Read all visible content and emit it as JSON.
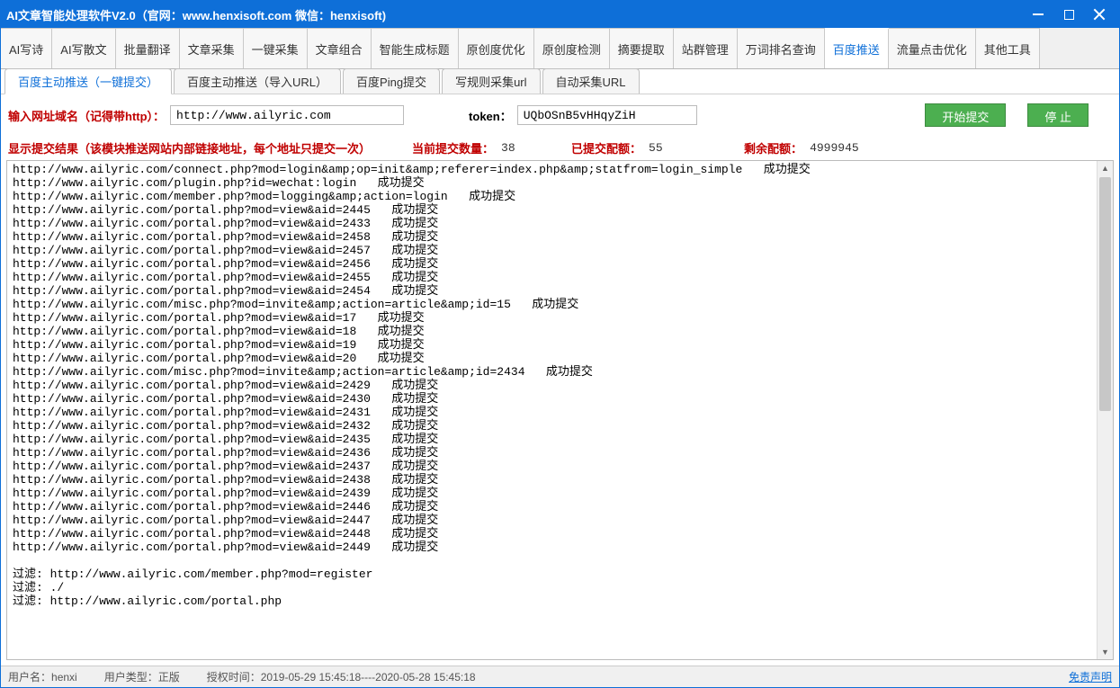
{
  "title": "AI文章智能处理软件V2.0（官网：www.henxisoft.com  微信：henxisoft)",
  "main_tabs": [
    "AI写诗",
    "AI写散文",
    "批量翻译",
    "文章采集",
    "一键采集",
    "文章组合",
    "智能生成标题",
    "原创度优化",
    "原创度检测",
    "摘要提取",
    "站群管理",
    "万词排名查询",
    "百度推送",
    "流量点击优化",
    "其他工具"
  ],
  "main_tab_active": 12,
  "sub_tabs": [
    "百度主动推送（一键提交）",
    "百度主动推送（导入URL）",
    "百度Ping提交",
    "写规则采集url",
    "自动采集URL"
  ],
  "sub_tab_active": 0,
  "input_row": {
    "domain_label": "输入网址域名（记得带http）：",
    "domain_value": "http://www.ailyric.com",
    "token_label": "token：",
    "token_value": "UQbOSnB5vHHqyZiH",
    "start_btn": "开始提交",
    "stop_btn": "停 止"
  },
  "result_header": {
    "title": "显示提交结果（该模块推送网站内部链接地址，每个地址只提交一次）",
    "current_label": "当前提交数量：",
    "current_value": "38",
    "done_label": "已提交配额：",
    "done_value": "55",
    "remain_label": "剩余配额：",
    "remain_value": "4999945"
  },
  "log_lines": [
    "http://www.ailyric.com/connect.php?mod=login&amp;op=init&amp;referer=index.php&amp;statfrom=login_simple   成功提交",
    "http://www.ailyric.com/plugin.php?id=wechat:login   成功提交",
    "http://www.ailyric.com/member.php?mod=logging&amp;action=login   成功提交",
    "http://www.ailyric.com/portal.php?mod=view&aid=2445   成功提交",
    "http://www.ailyric.com/portal.php?mod=view&aid=2433   成功提交",
    "http://www.ailyric.com/portal.php?mod=view&aid=2458   成功提交",
    "http://www.ailyric.com/portal.php?mod=view&aid=2457   成功提交",
    "http://www.ailyric.com/portal.php?mod=view&aid=2456   成功提交",
    "http://www.ailyric.com/portal.php?mod=view&aid=2455   成功提交",
    "http://www.ailyric.com/portal.php?mod=view&aid=2454   成功提交",
    "http://www.ailyric.com/misc.php?mod=invite&amp;action=article&amp;id=15   成功提交",
    "http://www.ailyric.com/portal.php?mod=view&aid=17   成功提交",
    "http://www.ailyric.com/portal.php?mod=view&aid=18   成功提交",
    "http://www.ailyric.com/portal.php?mod=view&aid=19   成功提交",
    "http://www.ailyric.com/portal.php?mod=view&aid=20   成功提交",
    "http://www.ailyric.com/misc.php?mod=invite&amp;action=article&amp;id=2434   成功提交",
    "http://www.ailyric.com/portal.php?mod=view&aid=2429   成功提交",
    "http://www.ailyric.com/portal.php?mod=view&aid=2430   成功提交",
    "http://www.ailyric.com/portal.php?mod=view&aid=2431   成功提交",
    "http://www.ailyric.com/portal.php?mod=view&aid=2432   成功提交",
    "http://www.ailyric.com/portal.php?mod=view&aid=2435   成功提交",
    "http://www.ailyric.com/portal.php?mod=view&aid=2436   成功提交",
    "http://www.ailyric.com/portal.php?mod=view&aid=2437   成功提交",
    "http://www.ailyric.com/portal.php?mod=view&aid=2438   成功提交",
    "http://www.ailyric.com/portal.php?mod=view&aid=2439   成功提交",
    "http://www.ailyric.com/portal.php?mod=view&aid=2446   成功提交",
    "http://www.ailyric.com/portal.php?mod=view&aid=2447   成功提交",
    "http://www.ailyric.com/portal.php?mod=view&aid=2448   成功提交",
    "http://www.ailyric.com/portal.php?mod=view&aid=2449   成功提交",
    "",
    "过滤: http://www.ailyric.com/member.php?mod=register",
    "过滤: ./",
    "过滤: http://www.ailyric.com/portal.php"
  ],
  "statusbar": {
    "user_label": "用户名：",
    "user_value": "henxi",
    "type_label": "用户类型：",
    "type_value": "正版",
    "auth_label": "授权时间：",
    "auth_value": "2019-05-29 15:45:18----2020-05-28 15:45:18",
    "disclaimer": "免责声明"
  }
}
